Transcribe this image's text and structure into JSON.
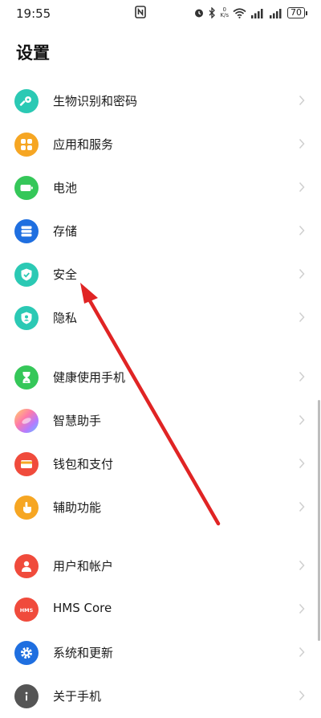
{
  "status_bar": {
    "time": "19:55",
    "net_speed_value": "0",
    "net_speed_unit": "K/s",
    "battery": "70"
  },
  "page_title": "设置",
  "items": [
    {
      "label": "生物识别和密码",
      "icon": "key-icon",
      "color": "#2BC9B4"
    },
    {
      "label": "应用和服务",
      "icon": "apps-grid-icon",
      "color": "#F6A623"
    },
    {
      "label": "电池",
      "icon": "battery-icon",
      "color": "#35C759"
    },
    {
      "label": "存储",
      "icon": "storage-icon",
      "color": "#1F6FE0"
    },
    {
      "label": "安全",
      "icon": "shield-check-icon",
      "color": "#2BC9B4"
    },
    {
      "label": "隐私",
      "icon": "privacy-shield-icon",
      "color": "#2BC9B4"
    },
    {
      "label": "健康使用手机",
      "icon": "hourglass-icon",
      "color": "#35C759"
    },
    {
      "label": "智慧助手",
      "icon": "assistant-orb-icon",
      "color": "#E06CE0"
    },
    {
      "label": "钱包和支付",
      "icon": "wallet-icon",
      "color": "#F04B3C"
    },
    {
      "label": "辅助功能",
      "icon": "hand-icon",
      "color": "#F6A623"
    },
    {
      "label": "用户和帐户",
      "icon": "user-icon",
      "color": "#F04B3C"
    },
    {
      "label": "HMS Core",
      "icon": "hms-icon",
      "color": "#F04B3C"
    },
    {
      "label": "系统和更新",
      "icon": "gear-icon",
      "color": "#1F6FE0"
    },
    {
      "label": "关于手机",
      "icon": "info-icon",
      "color": "#555555"
    }
  ],
  "annotation": {
    "color": "#E02424"
  }
}
